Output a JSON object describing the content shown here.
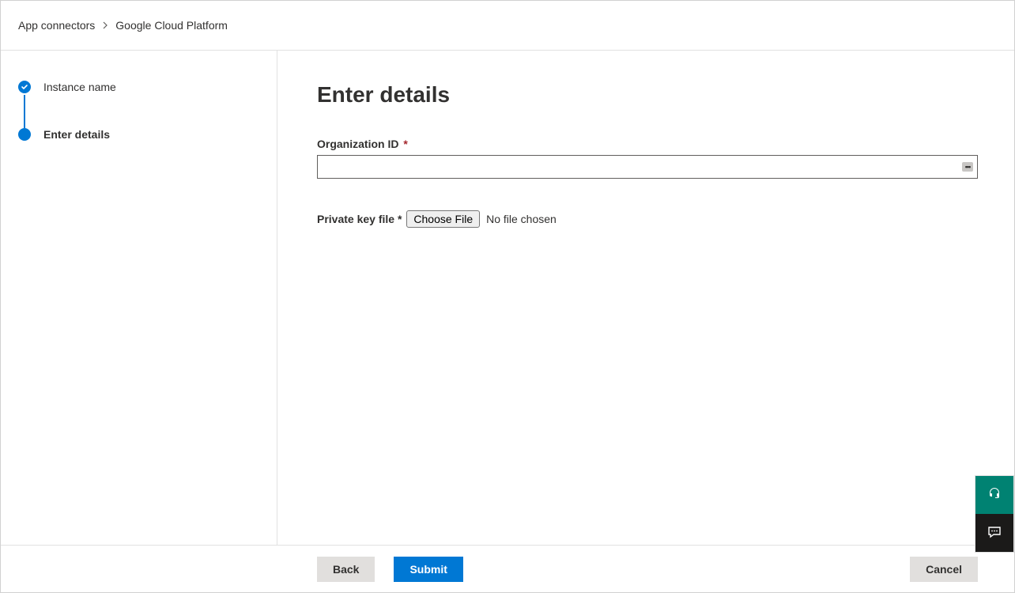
{
  "breadcrumb": {
    "parent": "App connectors",
    "current": "Google Cloud Platform"
  },
  "sidebar": {
    "steps": [
      {
        "label": "Instance name",
        "state": "done"
      },
      {
        "label": "Enter details",
        "state": "current"
      }
    ]
  },
  "main": {
    "title": "Enter details",
    "org_id_label": "Organization ID",
    "org_id_value": "",
    "private_key_label": "Private key file",
    "choose_file_label": "Choose File",
    "no_file_text": "No file chosen"
  },
  "footer": {
    "back": "Back",
    "submit": "Submit",
    "cancel": "Cancel"
  }
}
